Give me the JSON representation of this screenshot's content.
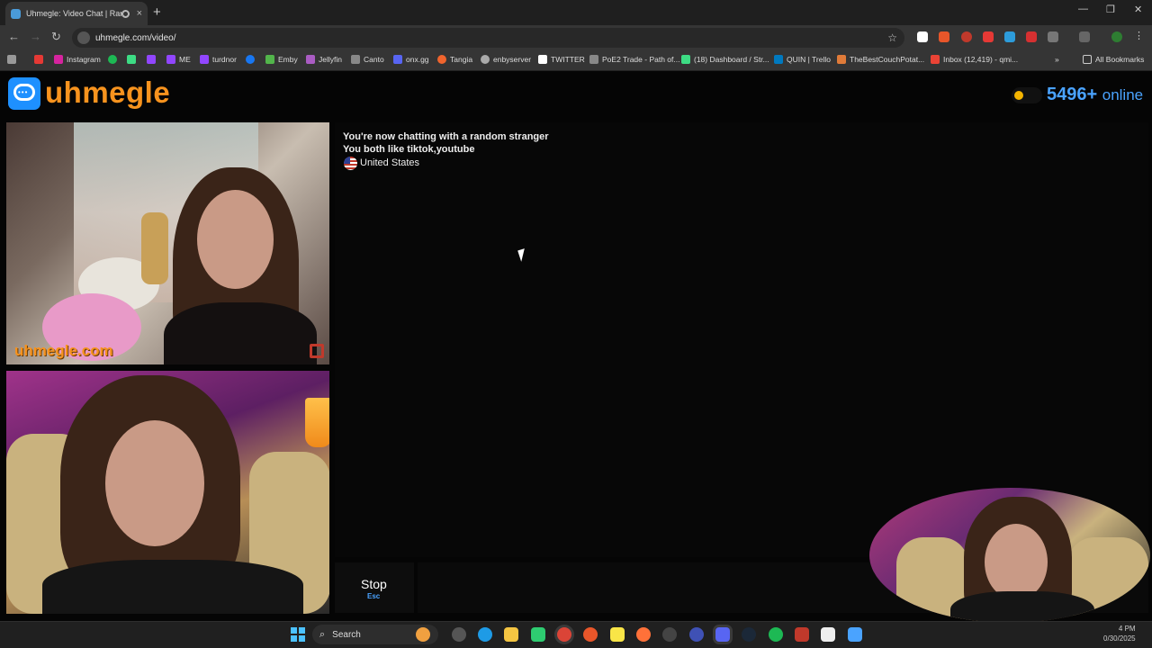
{
  "browser": {
    "tab_title": "Uhmegle: Video Chat | Ran",
    "tab_close": "×",
    "new_tab": "+",
    "window_controls": [
      "—",
      "❐",
      "✕"
    ],
    "nav": {
      "back": "←",
      "forward": "→",
      "reload": "↻"
    },
    "url": "uhmegle.com/video/",
    "bookmark_star": "☆",
    "bookmarks": [
      {
        "label": "",
        "color": "#e53935"
      },
      {
        "label": "Instagram",
        "color": "#d6249f"
      },
      {
        "label": "",
        "color": "#1db954"
      },
      {
        "label": "",
        "color": "#3ddc84"
      },
      {
        "label": "",
        "color": "#9146ff"
      },
      {
        "label": "ME",
        "color": "#9146ff"
      },
      {
        "label": "turdnor",
        "color": "#9146ff"
      },
      {
        "label": "",
        "color": "#1877f2"
      },
      {
        "label": "Emby",
        "color": "#52b54b"
      },
      {
        "label": "Jellyfin",
        "color": "#aa5cc3"
      },
      {
        "label": "Canto",
        "color": "#888888"
      },
      {
        "label": "onx.gg",
        "color": "#5865f2"
      },
      {
        "label": "Tangia",
        "color": "#f0642d"
      },
      {
        "label": "enbyserver",
        "color": "#aaaaaa"
      },
      {
        "label": "TWITTER",
        "color": "#ffffff"
      },
      {
        "label": "PoE2 Trade - Path of...",
        "color": "#888888"
      },
      {
        "label": "(18) Dashboard / Str...",
        "color": "#3ddc84"
      },
      {
        "label": "QUIN | Trello",
        "color": "#0079bf"
      },
      {
        "label": "TheBestCouchPotat...",
        "color": "#e07b39"
      },
      {
        "label": "Inbox (12,419) - qmi...",
        "color": "#ea4335"
      }
    ],
    "bookmarks_more": "»",
    "all_bookmarks": "All Bookmarks"
  },
  "site": {
    "logo_text": "uhmegle",
    "online_count": "5496+",
    "online_label": "online",
    "watermark": "uhmegle.com",
    "status": {
      "line1": "You're now chatting with a random stranger",
      "line2": "You both like tiktok,youtube",
      "country": "United States"
    },
    "stop": {
      "label": "Stop",
      "key": "Esc"
    },
    "message_placeholder": ""
  },
  "taskbar": {
    "search_label": "Search",
    "search_icon": "⌕",
    "time": "4 PM",
    "date": "0/30/2025"
  },
  "colors": {
    "brand_orange": "#f7931e",
    "accent_blue": "#4aa3ff",
    "logo_blue": "#1e90ff"
  }
}
